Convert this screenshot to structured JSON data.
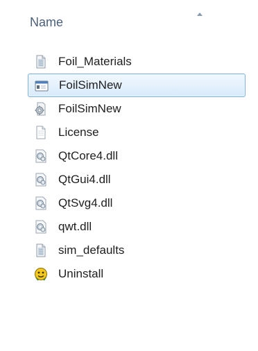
{
  "header": {
    "column_label": "Name"
  },
  "files": [
    {
      "name": "Foil_Materials",
      "icon": "text-file-icon",
      "selected": false
    },
    {
      "name": "FoilSimNew",
      "icon": "application-window-icon",
      "selected": true
    },
    {
      "name": "FoilSimNew",
      "icon": "config-file-icon",
      "selected": false
    },
    {
      "name": "License",
      "icon": "blank-document-icon",
      "selected": false
    },
    {
      "name": "QtCore4.dll",
      "icon": "dll-gear-icon",
      "selected": false
    },
    {
      "name": "QtGui4.dll",
      "icon": "dll-gear-icon",
      "selected": false
    },
    {
      "name": "QtSvg4.dll",
      "icon": "dll-gear-icon",
      "selected": false
    },
    {
      "name": "qwt.dll",
      "icon": "dll-gear-icon",
      "selected": false
    },
    {
      "name": "sim_defaults",
      "icon": "text-file-icon",
      "selected": false
    },
    {
      "name": "Uninstall",
      "icon": "uninstaller-icon",
      "selected": false
    }
  ]
}
